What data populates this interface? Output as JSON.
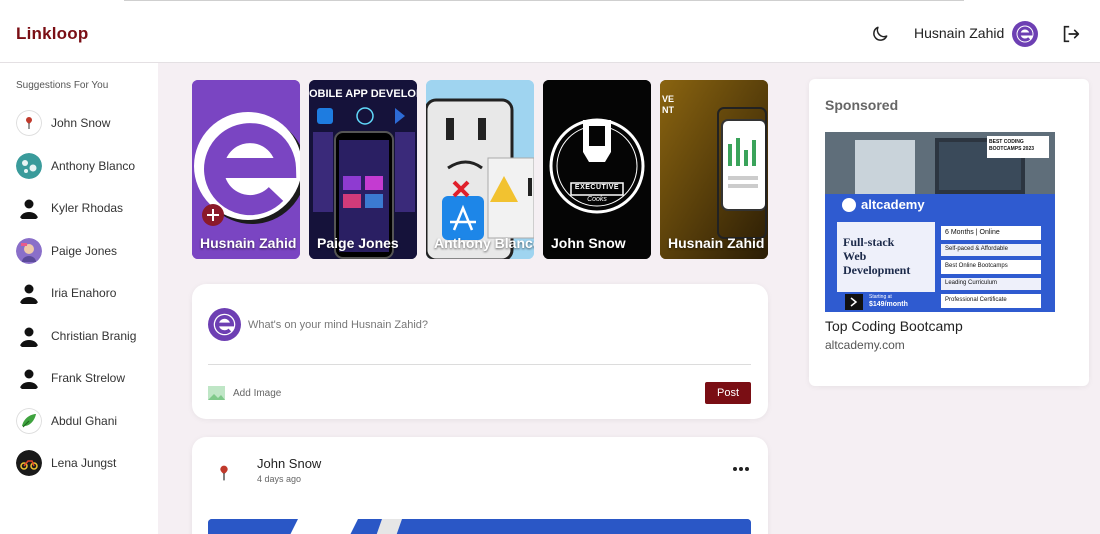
{
  "app": {
    "brand": "Linkloop"
  },
  "header": {
    "user_name": "Husnain Zahid",
    "theme_icon": "moon-icon",
    "logout_icon": "logout-icon"
  },
  "sidebar": {
    "title": "Suggestions For You",
    "items": [
      {
        "name": "John Snow"
      },
      {
        "name": "Anthony Blanco"
      },
      {
        "name": "Kyler Rhodas"
      },
      {
        "name": "Paige Jones"
      },
      {
        "name": "Iria Enahoro"
      },
      {
        "name": "Christian Branig"
      },
      {
        "name": "Frank Strelow"
      },
      {
        "name": "Abdul Ghani"
      },
      {
        "name": "Lena Jungst"
      }
    ]
  },
  "stories": [
    {
      "name": "Husnain Zahid"
    },
    {
      "name": "Paige Jones",
      "banner": "OBILE APP DEVELOPM"
    },
    {
      "name": "Anthony Blanco"
    },
    {
      "name": "John Snow",
      "badge_top": "EXECUTIVE",
      "badge_bottom": "Cooks"
    },
    {
      "name": "Husnain Zahid",
      "banner": "VE NT"
    }
  ],
  "composer": {
    "placeholder": "What's on your mind Husnain Zahid?",
    "add_image_label": "Add Image",
    "post_label": "Post"
  },
  "post": {
    "author": "John Snow",
    "time": "4 days ago"
  },
  "sponsored": {
    "title": "Sponsored",
    "ad_title": "Top Coding Bootcamp",
    "ad_url": "altcademy.com",
    "ad_image": {
      "brand": "altcademy",
      "headline_1": "Full-stack",
      "headline_2": "Web",
      "headline_3": "Development",
      "badge_1": "BEST CODING",
      "badge_2": "BOOTCAMPS 2023",
      "feature_1": "6 Months | Online",
      "feature_2": "Self-paced & Affordable",
      "feature_3": "Best Online Bootcamps",
      "feature_4": "Leading Curriculum",
      "feature_5": "Professional Certificate",
      "price_1": "Starting at",
      "price_2": "$149/month"
    }
  },
  "colors": {
    "brand": "#7a0e14",
    "accent_purple": "#6d3fb3",
    "background": "#f5eff3"
  }
}
